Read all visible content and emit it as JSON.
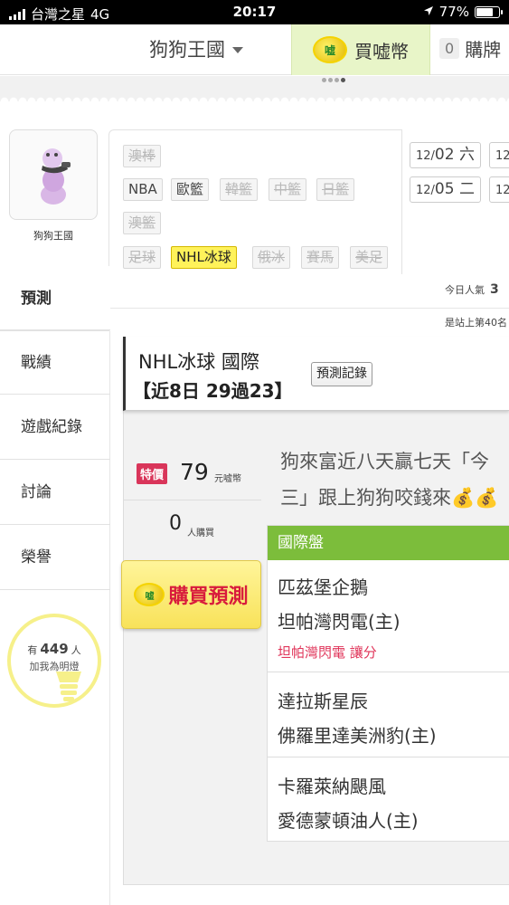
{
  "status_bar": {
    "carrier": "台灣之星",
    "network": "4G",
    "time": "20:17",
    "battery": "77%",
    "battery_level": 0.77
  },
  "top_nav": {
    "site_name": "狗狗王國",
    "buy_coins_label": "買嘘幣",
    "coin_text": "嘘",
    "cart_count": "0",
    "cart_label": "購牌"
  },
  "profile": {
    "name": "狗狗王國"
  },
  "sports_filter": {
    "rows": [
      [
        {
          "label": "澳棒",
          "state": "disabled"
        }
      ],
      [
        {
          "label": "NBA",
          "state": "normal"
        },
        {
          "label": "歐籃",
          "state": "normal"
        },
        {
          "label": "韓籃",
          "state": "disabled"
        },
        {
          "label": "中籃",
          "state": "disabled"
        },
        {
          "label": "日籃",
          "state": "disabled"
        }
      ],
      [
        {
          "label": "澳籃",
          "state": "disabled"
        }
      ],
      [
        {
          "label": "足球",
          "state": "disabled"
        },
        {
          "label": "NHL冰球",
          "state": "active"
        },
        {
          "label": "俄冰",
          "state": "disabled"
        },
        {
          "label": "賽馬",
          "state": "disabled"
        },
        {
          "label": "美足",
          "state": "disabled"
        }
      ]
    ]
  },
  "dates": [
    {
      "month": "12/",
      "day": "02",
      "weekday": "六"
    },
    {
      "month": "12/",
      "day": "05",
      "weekday": "二"
    },
    {
      "month": "12",
      "day": "",
      "weekday": ""
    },
    {
      "month": "12",
      "day": "",
      "weekday": ""
    }
  ],
  "sidebar": {
    "items": [
      "預測",
      "戰績",
      "遊戲紀錄",
      "討論",
      "榮譽"
    ],
    "active": "預測",
    "bulb_prefix": "有",
    "bulb_count": "449",
    "bulb_suffix": "人",
    "bulb_caption": "加我為明燈"
  },
  "stats": {
    "popularity_label": "今日人氣",
    "popularity_value": "3",
    "rank_text": "是站上第40名"
  },
  "prediction": {
    "league": "NHL冰球 國際",
    "record": "【近8日 29過23】",
    "record_button": "預測記錄",
    "special_label": "特價",
    "price": "79",
    "price_unit": "元嘘幣",
    "buyers": "0",
    "buyers_unit": "人購買",
    "buy_button": "購買預測",
    "desc_line1": "狗來富近八天贏七天「今",
    "desc_line2": "三」跟上狗狗咬錢來💰💰",
    "games_header": "國際盤",
    "games": [
      {
        "away": "匹茲堡企鵝",
        "home": "坦帕灣閃電(主)",
        "spread": "坦帕灣閃電 讓分"
      },
      {
        "away": "達拉斯星辰",
        "home": "佛羅里達美洲豹(主)",
        "spread": ""
      },
      {
        "away": "卡羅萊納颶風",
        "home": "愛德蒙頓油人(主)",
        "spread": ""
      }
    ]
  }
}
